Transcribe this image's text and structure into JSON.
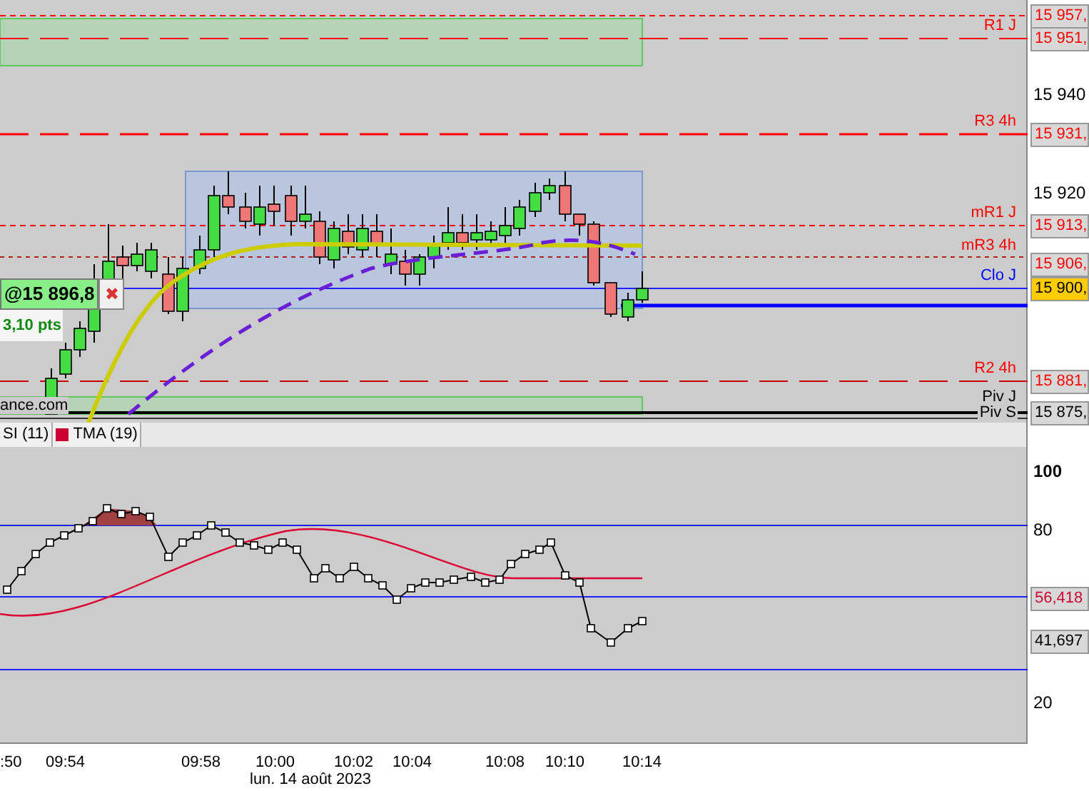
{
  "line_labels": [
    {
      "text": "R1 J",
      "color": "#ff0000"
    },
    {
      "text": "R3 4h",
      "color": "#ff0000"
    },
    {
      "text": "mR1 J",
      "color": "#ff0000"
    },
    {
      "text": "mR3 4h",
      "color": "#ff0000"
    },
    {
      "text": "Clo J",
      "color": "#0000ff"
    },
    {
      "text": "R2 4h",
      "color": "#ff0000"
    },
    {
      "text": "Piv J",
      "color": "#000000"
    },
    {
      "text": "Piv S",
      "color": "#000000"
    }
  ],
  "price_axis": [
    {
      "text": "15 957,",
      "kind": "tag",
      "color": "#ff0000"
    },
    {
      "text": "15 951,",
      "kind": "tag",
      "color": "#ff0000"
    },
    {
      "text": "15 940",
      "kind": "tick"
    },
    {
      "text": "15 931,",
      "kind": "tag",
      "color": "#ff0000"
    },
    {
      "text": "15 920",
      "kind": "tick"
    },
    {
      "text": "15 913,",
      "kind": "tag",
      "color": "#ff0000"
    },
    {
      "text": "15 906,",
      "kind": "tag",
      "color": "#ff0000"
    },
    {
      "text": "15 900,",
      "kind": "current"
    },
    {
      "text": "15 881,",
      "kind": "tag",
      "color": "#ff0000"
    },
    {
      "text": "15 875,",
      "kind": "tag",
      "color": "#000000"
    }
  ],
  "order": {
    "price": "@15 896,8",
    "close": "✖",
    "points": "3,10 pts"
  },
  "source_text": "ance.com",
  "indicator_tabs": [
    {
      "label": "SI (11)"
    },
    {
      "label": "TMA (19)",
      "color": "#cc0033"
    }
  ],
  "indicator_axis": [
    {
      "text": "100",
      "kind": "major"
    },
    {
      "text": "80",
      "kind": "tick"
    },
    {
      "text": "56,418",
      "kind": "tag",
      "color": "#cc0033"
    },
    {
      "text": "41,697",
      "kind": "tag",
      "color": "#000000"
    },
    {
      "text": "20",
      "kind": "tick"
    }
  ],
  "time_axis": {
    "ticks": [
      ":50",
      "09:54",
      "09:58",
      "10:00",
      "10:02",
      "10:04",
      "10:08",
      "10:10",
      "10:14"
    ],
    "date": "lun. 14 août 2023"
  }
}
